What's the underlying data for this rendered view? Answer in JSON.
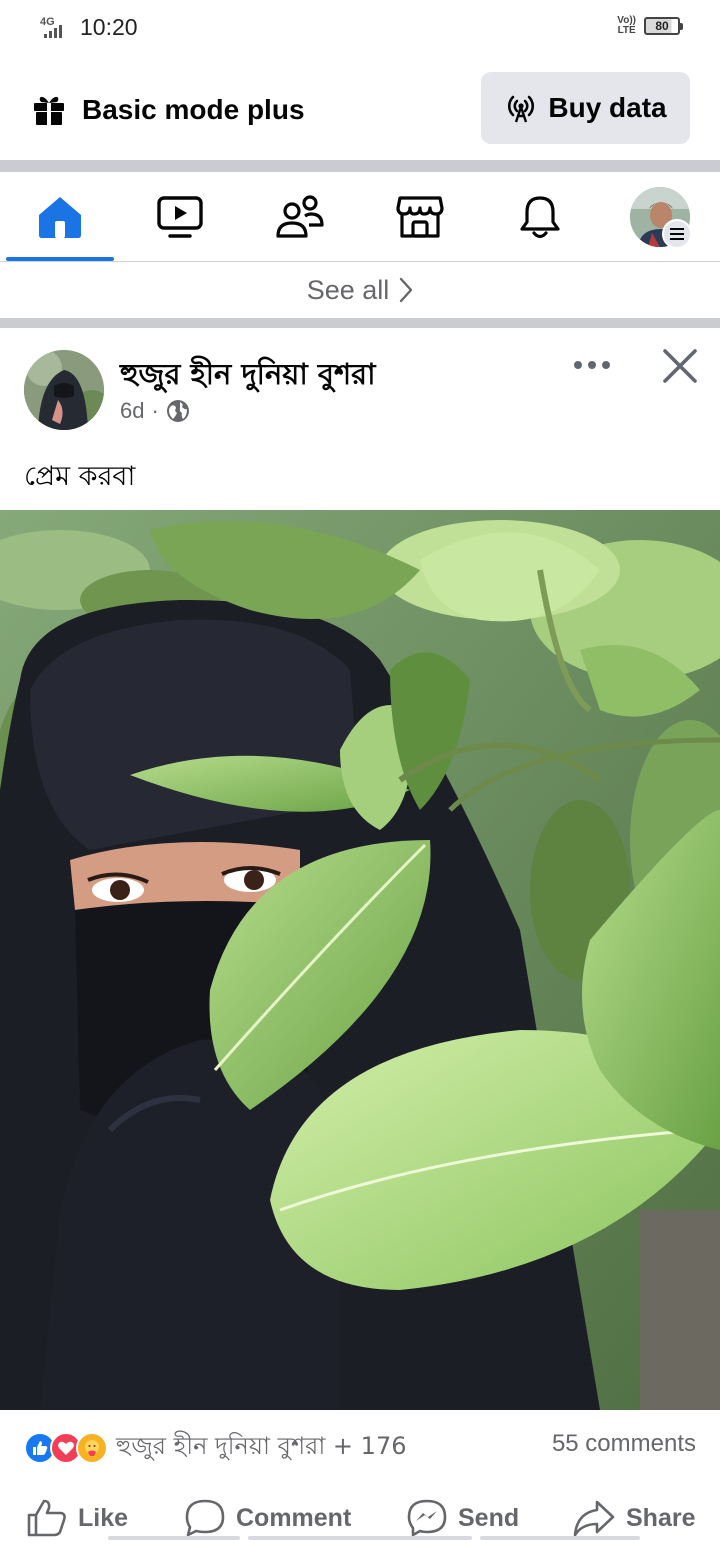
{
  "status_bar": {
    "network": "4G",
    "time": "10:20",
    "volte": [
      "Vo))",
      "LTE"
    ],
    "battery": "80"
  },
  "top_bar": {
    "title": "Basic mode plus",
    "title_icon": "gift-icon",
    "buy_data_label": "Buy data",
    "buy_data_icon": "broadcast-antenna-icon"
  },
  "nav": {
    "active_color": "#1b74e4",
    "items": [
      {
        "icon": "home-icon",
        "active": true
      },
      {
        "icon": "video-icon",
        "active": false
      },
      {
        "icon": "friends-icon",
        "active": false
      },
      {
        "icon": "marketplace-icon",
        "active": false
      },
      {
        "icon": "notifications-bell-icon",
        "active": false
      },
      {
        "icon": "profile-avatar",
        "active": false
      }
    ]
  },
  "see_all": {
    "label": "See all"
  },
  "post": {
    "author": "হুজুর হীন দুনিয়া বুশরা",
    "age": "6d",
    "dot": "·",
    "privacy_icon": "globe-icon",
    "text": "প্রেম করবা",
    "reactions": {
      "icons": [
        "like-icon",
        "love-icon",
        "care-icon"
      ],
      "names": "হুজুর হীন দুনিয়া বুশরা + 176",
      "comments": "55 comments"
    },
    "actions": [
      {
        "label": "Like",
        "icon": "thumbs-up-icon"
      },
      {
        "label": "Comment",
        "icon": "comment-bubble-icon"
      },
      {
        "label": "Send",
        "icon": "messenger-icon"
      },
      {
        "label": "Share",
        "icon": "share-arrow-icon"
      }
    ]
  },
  "colors": {
    "accent": "#1b74e4",
    "secondary_text": "#65676b",
    "button_bg": "#e4e6eb",
    "separator": "#c9ccd1",
    "like": "#1877f2",
    "love": "#f33e58",
    "care": "#f7b125"
  }
}
